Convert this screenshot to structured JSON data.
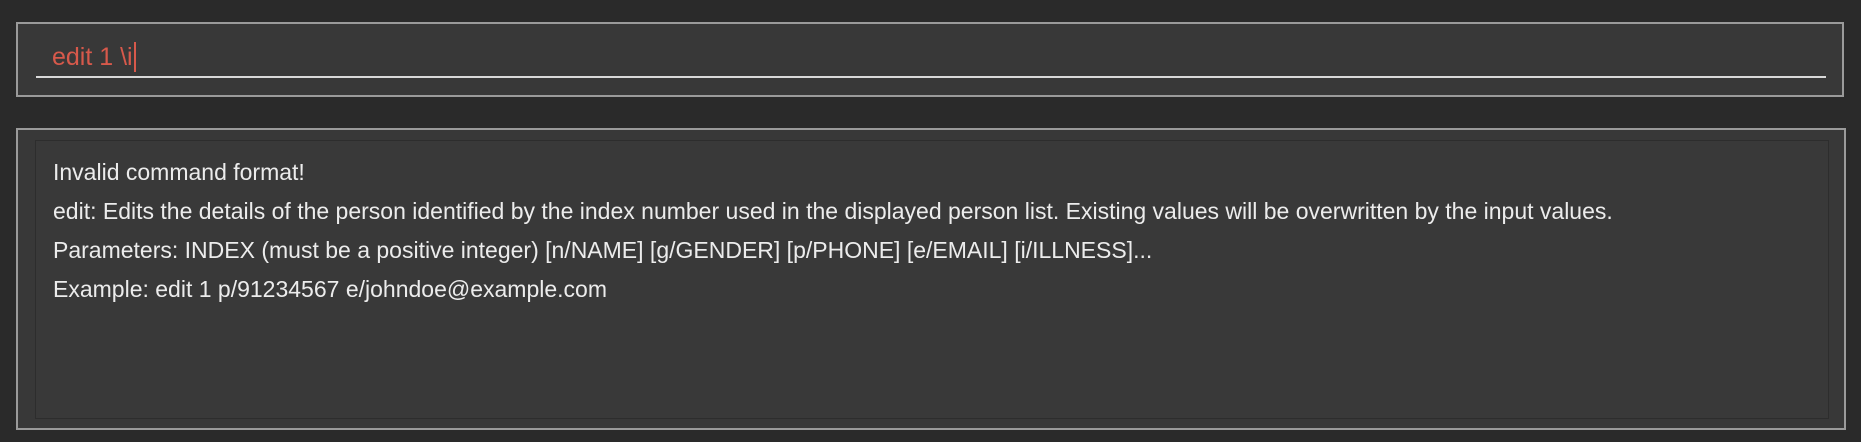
{
  "command_box": {
    "value": "edit 1 \\i"
  },
  "result_display": {
    "lines": [
      "Invalid command format!",
      "edit: Edits the details of the person identified by the index number used in the displayed person list. Existing values will be overwritten by the input values.",
      "Parameters: INDEX (must be a positive integer) [n/NAME] [g/GENDER] [p/PHONE] [e/EMAIL] [i/ILLNESS]...",
      "Example: edit 1 p/91234567 e/johndoe@example.com"
    ]
  },
  "colors": {
    "background": "#2a2a2a",
    "panel": "#383838",
    "error_text": "#d7594b",
    "result_text": "#ececec",
    "border": "#9a9a9a"
  }
}
